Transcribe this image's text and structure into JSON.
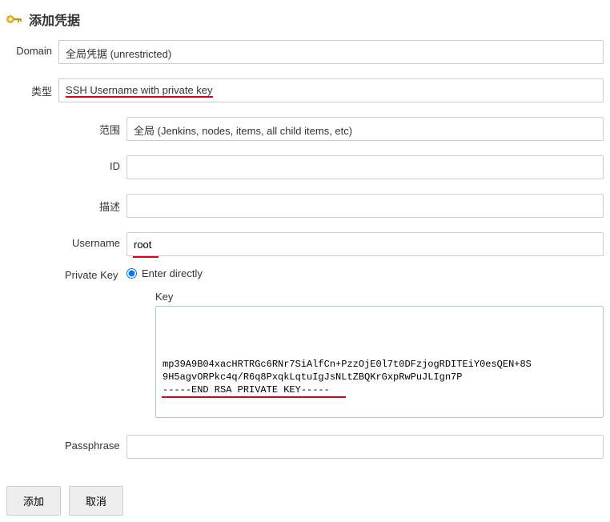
{
  "header": {
    "title": "添加凭据"
  },
  "labels": {
    "domain": "Domain",
    "type": "类型",
    "scope": "范围",
    "id": "ID",
    "description": "描述",
    "username": "Username",
    "private_key": "Private Key",
    "enter_directly": "Enter directly",
    "key": "Key",
    "passphrase": "Passphrase"
  },
  "values": {
    "domain": "全局凭据 (unrestricted)",
    "type": "SSH Username with private key",
    "scope": "全局 (Jenkins, nodes, items, all child items, etc)",
    "id": "",
    "description": "",
    "username": "root",
    "key_text": "mp39A9B04xacHRTRGc6RNr7SiAlfCn+PzzOjE0l7t0DFzjogRDITEiY0esQEN+8S\n9H5agvORPkc4q/R6q8PxqkLqtuIgJsNLtZBQKrGxpRwPuJLIgn7P\n-----END RSA PRIVATE KEY-----",
    "passphrase": ""
  },
  "buttons": {
    "add": "添加",
    "cancel": "取消"
  }
}
